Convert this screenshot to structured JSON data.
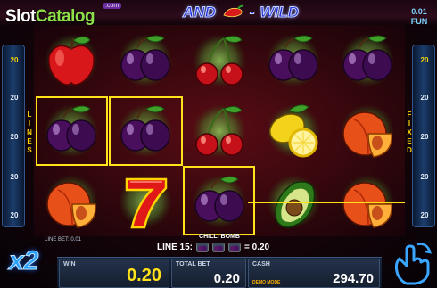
{
  "brand": {
    "slot": "Slot",
    "catalog": "Catalog",
    "dotcom": ".com"
  },
  "banner": {
    "and": "AND",
    "dash": "-",
    "wild": "WILD"
  },
  "denomination": {
    "value": "0.01",
    "currency": "FUN"
  },
  "left_rail": {
    "numbers": [
      "20",
      "20",
      "20",
      "20",
      "20"
    ],
    "label": "LINES"
  },
  "right_rail": {
    "numbers": [
      "20",
      "20",
      "20",
      "20",
      "20"
    ],
    "label": "FIXED"
  },
  "reels": [
    [
      "apple",
      "plum",
      "cherry",
      "plum",
      "plum"
    ],
    [
      "plum",
      "plum",
      "cherry",
      "lemon",
      "peach"
    ],
    [
      "peach",
      "seven",
      "plum",
      "avocado",
      "peach"
    ]
  ],
  "win_symbol_label": "CHILLI BOMB",
  "line_bet": "LINE BET: 0.01",
  "line_win": {
    "prefix": "LINE 15:",
    "suffix": "= 0.20"
  },
  "multiplier": "x2",
  "win": {
    "label": "WIN",
    "value": "0.20"
  },
  "total_bet": {
    "label": "TOTAL BET",
    "value": "0.20"
  },
  "cash": {
    "label": "CASH",
    "value": "294.70",
    "demo": "DEMO MODE"
  },
  "colors": {
    "highlight": "#ffe21a",
    "rail": "#1c3d6c",
    "multiplier": "#2aa0ff"
  },
  "icons": {
    "spin": "hand-spin-icon",
    "banner": "chili-pepper-icon"
  }
}
